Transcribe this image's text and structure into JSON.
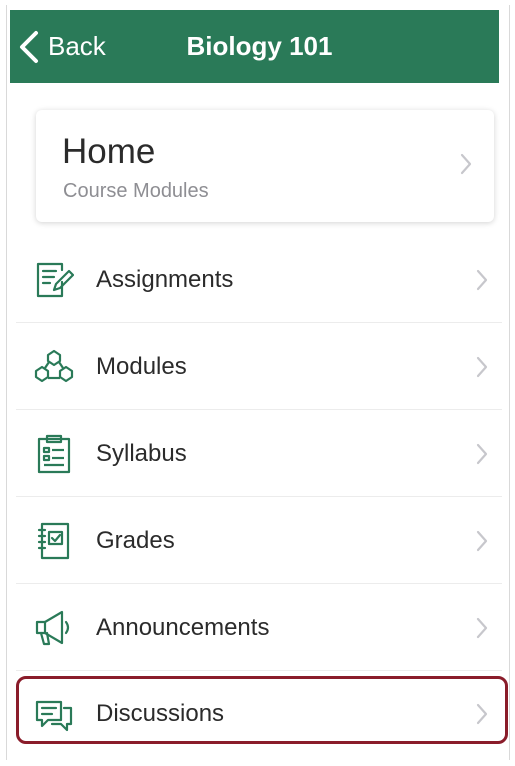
{
  "nav": {
    "back_label": "Back",
    "title": "Biology 101"
  },
  "home": {
    "title": "Home",
    "subtitle": "Course Modules"
  },
  "menu": [
    {
      "label": "Assignments",
      "icon": "assignments-icon"
    },
    {
      "label": "Modules",
      "icon": "modules-icon"
    },
    {
      "label": "Syllabus",
      "icon": "syllabus-icon"
    },
    {
      "label": "Grades",
      "icon": "grades-icon"
    },
    {
      "label": "Announcements",
      "icon": "announcements-icon"
    },
    {
      "label": "Discussions",
      "icon": "discussions-icon"
    }
  ],
  "colors": {
    "navbar": "#2a7a58",
    "icon": "#2a7a58",
    "highlight": "#8a1c2a",
    "chevron": "#c7c7cc"
  }
}
